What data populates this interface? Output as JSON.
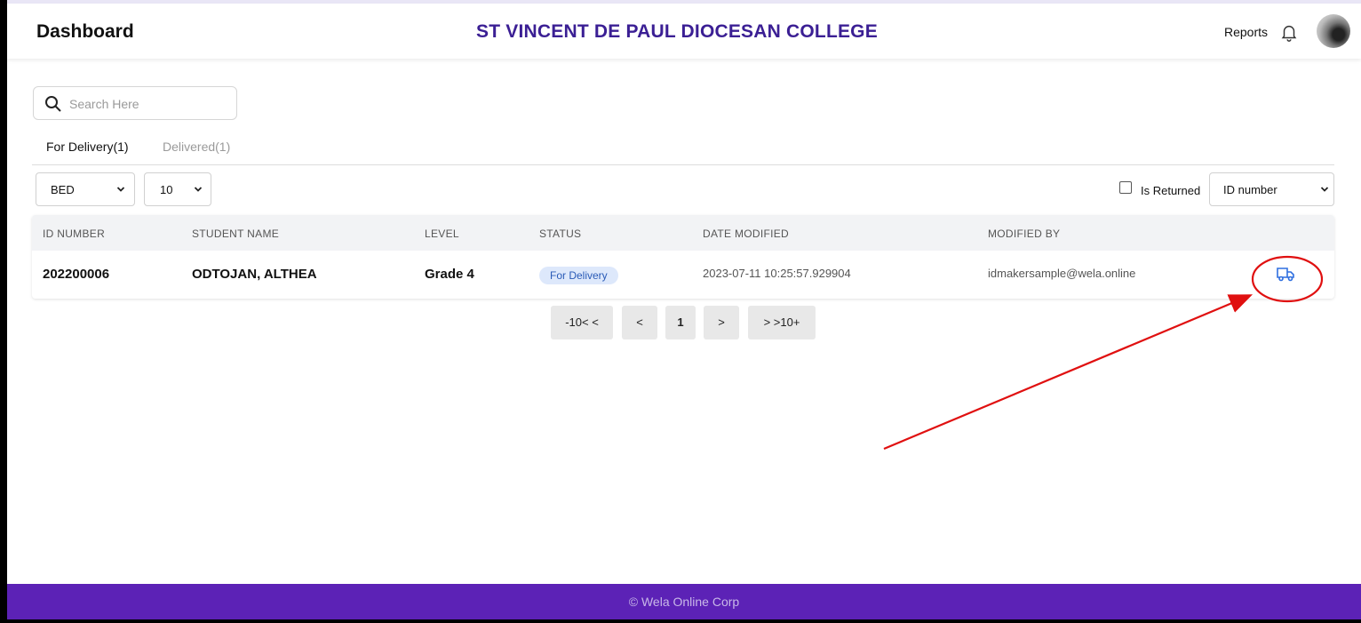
{
  "header": {
    "title": "Dashboard",
    "school_name": "ST VINCENT DE PAUL DIOCESAN COLLEGE",
    "reports_label": "Reports"
  },
  "search": {
    "placeholder": "Search Here",
    "value": ""
  },
  "tabs": [
    {
      "label": "For Delivery(1)",
      "active": true
    },
    {
      "label": "Delivered(1)",
      "active": false
    }
  ],
  "filters": {
    "department": "BED",
    "page_size": "10",
    "is_returned_label": "Is Returned",
    "is_returned_checked": false,
    "search_by": "ID number"
  },
  "table": {
    "columns": [
      "ID NUMBER",
      "STUDENT NAME",
      "LEVEL",
      "STATUS",
      "DATE MODIFIED",
      "MODIFIED BY"
    ],
    "rows": [
      {
        "id_number": "202200006",
        "student_name": "ODTOJAN, ALTHEA",
        "level": "Grade 4",
        "status": "For Delivery",
        "date_modified": "2023-07-11 10:25:57.929904",
        "modified_by": "idmakersample@wela.online",
        "action_icon": "truck-icon"
      }
    ]
  },
  "pagination": {
    "prev10": "-10< <",
    "prev": "<",
    "page": "1",
    "next": ">",
    "next10": "> >10+"
  },
  "footer": {
    "text": "© Wela Online Corp"
  },
  "colors": {
    "brand_purple": "#5c22b6",
    "school_title": "#3b1f94",
    "status_badge_bg": "#dde8fb",
    "status_badge_text": "#2a5bb7",
    "annotation_red": "#e01010"
  }
}
